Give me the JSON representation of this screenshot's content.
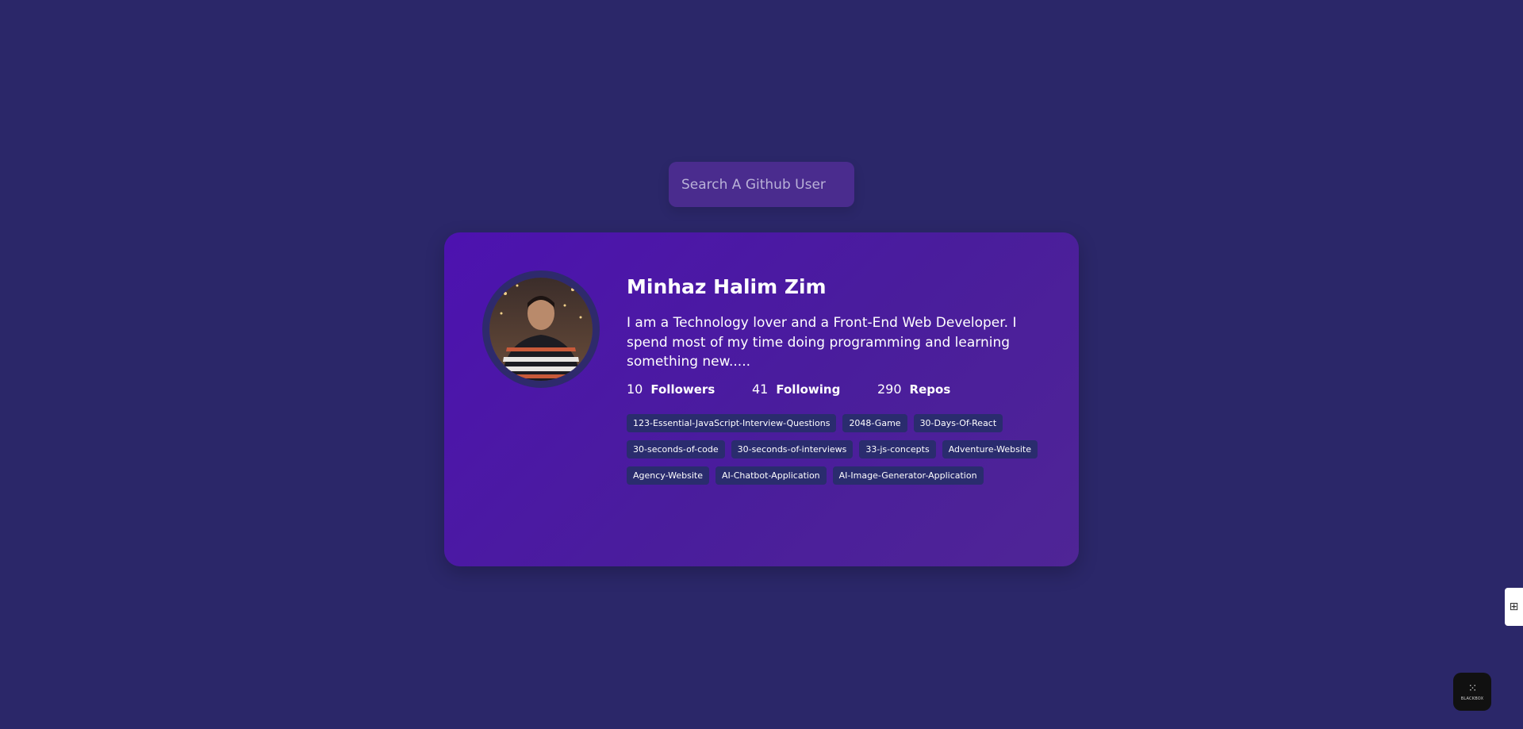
{
  "search": {
    "placeholder": "Search A Github User",
    "value": ""
  },
  "profile": {
    "name": "Minhaz Halim Zim",
    "bio": "I am a Technology lover and a Front-End Web Developer. I spend most of my time doing programming and learning something new.....",
    "stats": {
      "followers_count": "10",
      "followers_label": "Followers",
      "following_count": "41",
      "following_label": "Following",
      "repos_count": "290",
      "repos_label": "Repos"
    },
    "repos": [
      "123-Essential-JavaScript-Interview-Questions",
      "2048-Game",
      "30-Days-Of-React",
      "30-seconds-of-code",
      "30-seconds-of-interviews",
      "33-js-concepts",
      "Adventure-Website",
      "Agency-Website",
      "AI-Chatbot-Application",
      "AI-Image-Generator-Application"
    ]
  },
  "side_tab": {
    "icon": "side-panel-icon"
  },
  "blackbox": {
    "label": "BLACKBOX",
    "icon": "blackbox-logo-icon"
  },
  "colors": {
    "background": "#2b2769",
    "card": "#4d12b0",
    "search_bg": "#4a2c8e",
    "repo_tag": "#2a2c6e",
    "avatar_border": "#2e2a6c"
  }
}
